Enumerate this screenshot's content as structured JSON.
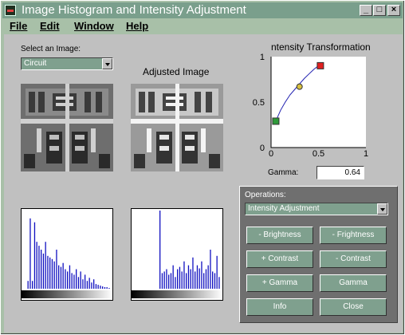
{
  "window": {
    "title": "Image Histogram and Intensity Adjustment",
    "controls": {
      "minimize": "_",
      "maximize": "□",
      "close": "×"
    }
  },
  "menu": {
    "items": [
      "File",
      "Edit",
      "Window",
      "Help"
    ]
  },
  "image_select": {
    "label": "Select an Image:",
    "value": "Circuit"
  },
  "adjusted_image": {
    "label": "Adjusted Image"
  },
  "transform_plot": {
    "title": "ntensity Transformation",
    "x_ticks": [
      "0",
      "0.5",
      "1"
    ],
    "y_ticks": [
      "0",
      "0.5",
      "1"
    ],
    "xlim": [
      0,
      1
    ],
    "ylim": [
      0,
      1
    ],
    "curve": {
      "x": [
        0.05,
        0.1,
        0.15,
        0.2,
        0.25,
        0.3,
        0.35,
        0.4,
        0.45,
        0.5
      ],
      "y": [
        0.29,
        0.41,
        0.5,
        0.58,
        0.64,
        0.7,
        0.76,
        0.81,
        0.86,
        0.9
      ]
    },
    "handles": [
      {
        "x": 0.05,
        "y": 0.29,
        "color": "#2e9a3a"
      },
      {
        "x": 0.3,
        "y": 0.67,
        "color": "#d8c040"
      },
      {
        "x": 0.52,
        "y": 0.9,
        "color": "#e02020"
      }
    ],
    "curve_color": "#2020b0"
  },
  "gamma": {
    "label": "Gamma:",
    "value": "0.64"
  },
  "operations": {
    "label": "Operations:",
    "selected": "Intensity Adjustment",
    "buttons": [
      "- Brightness",
      "- Frightness",
      "+ Contrast",
      "- Contrast",
      "+ Gamma",
      "Gamma",
      "Info",
      "Close"
    ]
  },
  "histograms": {
    "bar_color": "#1010c0",
    "original": [
      0.0,
      0.0,
      0.1,
      0.9,
      0.1,
      0.85,
      0.6,
      0.55,
      0.5,
      0.45,
      0.6,
      0.42,
      0.4,
      0.38,
      0.35,
      0.5,
      0.3,
      0.28,
      0.33,
      0.25,
      0.22,
      0.3,
      0.2,
      0.18,
      0.25,
      0.15,
      0.22,
      0.12,
      0.18,
      0.1,
      0.14,
      0.08,
      0.12,
      0.06,
      0.05,
      0.04,
      0.03,
      0.02,
      0.02,
      0.01
    ],
    "adjusted": [
      0.0,
      0.0,
      0.0,
      0.0,
      0.0,
      0.0,
      0.0,
      0.0,
      0.0,
      0.0,
      0.0,
      0.0,
      1.0,
      0.2,
      0.22,
      0.25,
      0.18,
      0.2,
      0.3,
      0.15,
      0.25,
      0.28,
      0.22,
      0.35,
      0.2,
      0.3,
      0.25,
      0.4,
      0.22,
      0.3,
      0.26,
      0.35,
      0.2,
      0.25,
      0.3,
      0.5,
      0.22,
      0.2,
      0.42,
      0.15
    ]
  }
}
